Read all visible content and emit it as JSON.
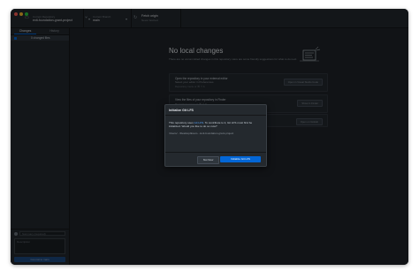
{
  "toolbar": {
    "repo": {
      "label": "Current Repository",
      "value": "exit-foundation-grant-project"
    },
    "branch": {
      "label": "Current Branch",
      "value": "main"
    },
    "fetch": {
      "label": "Fetch origin",
      "sub": "Never fetched"
    }
  },
  "sidebar": {
    "tabs": [
      "Changes",
      "History"
    ],
    "changed_files_label": "0 changed files",
    "commit": {
      "summary_placeholder": "Summary (required)",
      "description_placeholder": "Description",
      "button_label": "Commit to main"
    }
  },
  "main": {
    "heading": "No local changes",
    "subtext": "There are no uncommitted changes in this repository. Here are some friendly suggestions for what to do next.",
    "suggestions": [
      {
        "title": "Open the repository in your external editor",
        "sub": "Select your editor in Preferences",
        "meta": "Repository menu or ⌘ ⇧ A",
        "button": "Open in Visual Studio Code"
      },
      {
        "title": "View the files of your repository in Finder",
        "sub": "",
        "meta": "Repository menu or ⌘ ⇧ F",
        "button": "Show in Finder"
      },
      {
        "title": "",
        "sub": "",
        "meta": "",
        "button": "Open on GitHub"
      }
    ]
  },
  "dialog": {
    "title": "Initialize Git LFS",
    "body_prefix": "This repository uses ",
    "body_link": "Git LFS",
    "body_suffix": ". To contribute to it, Git LFS must first be initialized. Would you like to do so now?",
    "path": "/Users/.../Desktop/Exam.../exit-foundation-grant-project",
    "secondary_button": "Not Now",
    "primary_button": "Initialize Git LFS"
  },
  "colors": {
    "accent": "#0366d6",
    "background": "#1f2428",
    "panel": "#24292e"
  }
}
